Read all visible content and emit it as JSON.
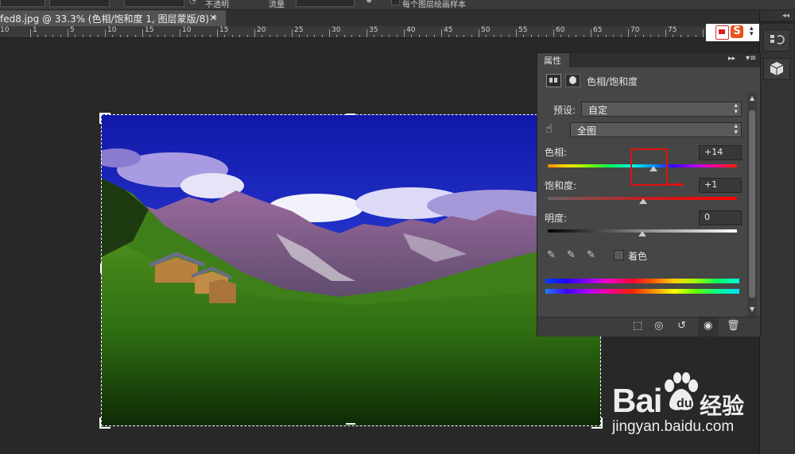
{
  "options_bar": {
    "label1": "不透明",
    "label2": "流量",
    "label3": "每个图层绘画样本"
  },
  "document_tab": {
    "title": "fed8.jpg @ 33.3% (色相/饱和度 1, 图层蒙版/8) *",
    "close": "×"
  },
  "ruler": {
    "labels": [
      "10",
      "1",
      "5",
      "10",
      "15",
      "10",
      "15",
      "20",
      "25",
      "30",
      "35",
      "40",
      "45",
      "50",
      "55",
      "60",
      "65",
      "70",
      "75",
      "80"
    ]
  },
  "properties_panel": {
    "tab_label": "属性",
    "title": "色相/饱和度",
    "preset_label": "预设:",
    "preset_value": "自定",
    "channel_value": "全图",
    "hue_label": "色相:",
    "hue_value": "+14",
    "hue_level": 0.56,
    "saturation_label": "饱和度:",
    "saturation_value": "+1",
    "saturation_level": 0.505,
    "lightness_label": "明度:",
    "lightness_value": "0",
    "lightness_level": 0.5,
    "colorize_label": "着色",
    "colorize_checked": false
  },
  "watermark": {
    "brand": "Bai",
    "brand_cn": "经验",
    "url": "jingyan.baidu.com"
  },
  "colors": {
    "highlight_box": "#e01010",
    "panel_bg": "#464646",
    "canvas_bg": "#282828"
  }
}
